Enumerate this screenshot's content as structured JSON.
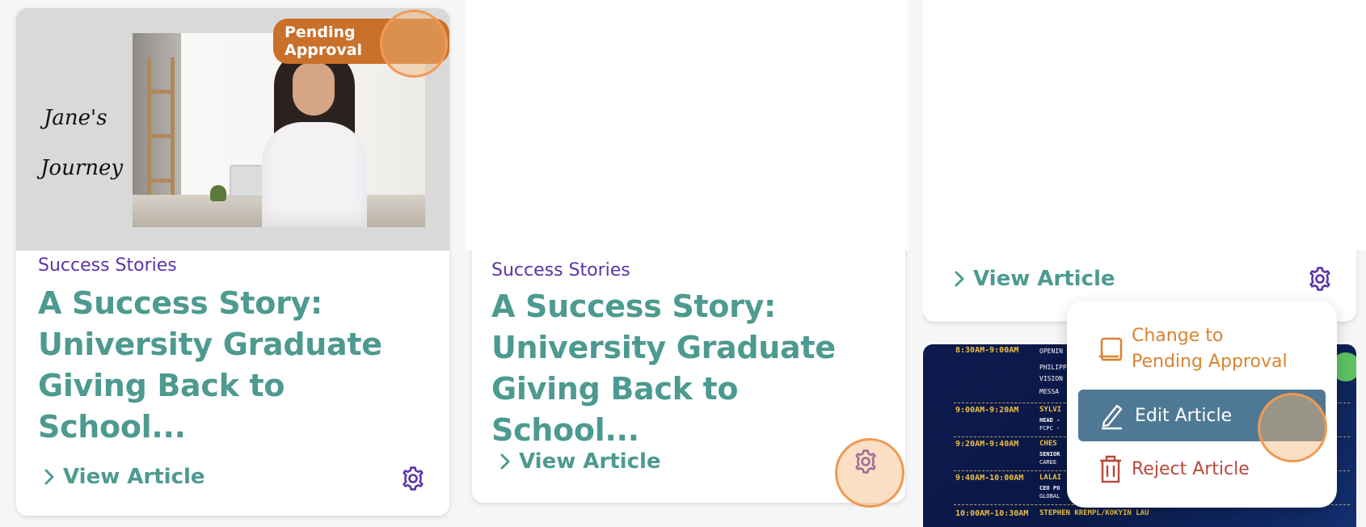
{
  "card1": {
    "badge": "Pending Approval",
    "image_text_line1": "Jane's",
    "image_text_line2": "Journey",
    "category": "Success Stories",
    "title": "A Success Story: University Graduate Giving Back to School...",
    "view_label": "View Article"
  },
  "card2": {
    "category": "Success Stories",
    "title": "A Success Story: University Graduate Giving Back to School...",
    "view_label": "View Article"
  },
  "card3": {
    "view_label": "View Article"
  },
  "menu": {
    "change_label_line1": "Change to",
    "change_label_line2": "Pending Approval",
    "edit_label": "Edit Article",
    "reject_label": "Reject Article"
  },
  "schedule": {
    "rows": [
      {
        "time": "8:30AM-9:00AM",
        "lines": [
          "OPENIN",
          "PHILIPP",
          "VISION",
          "MESSA"
        ]
      },
      {
        "time": "9:00AM-9:20AM",
        "lines": [
          "SYLVI",
          "HEAD -",
          "FCPC -"
        ]
      },
      {
        "time": "9:20AM-9:40AM",
        "lines": [
          "CHES",
          "SENIOR",
          "CAREE"
        ]
      },
      {
        "time": "9:40AM-10:00AM",
        "lines": [
          "LALAI",
          "CEO PO",
          "GLOBAL"
        ]
      },
      {
        "time": "10:00AM-10:30AM",
        "lines": [
          "STEPHEN KREMPL/KOKYIN LAU"
        ]
      }
    ]
  },
  "colors": {
    "accent_teal": "#4d9a90",
    "category_purple": "#5b34a6",
    "badge_orange": "#c9702b",
    "menu_orange": "#d9832f",
    "edit_bg": "#4f7894",
    "reject_red": "#b54a3c",
    "highlight": "#ef9a52"
  }
}
